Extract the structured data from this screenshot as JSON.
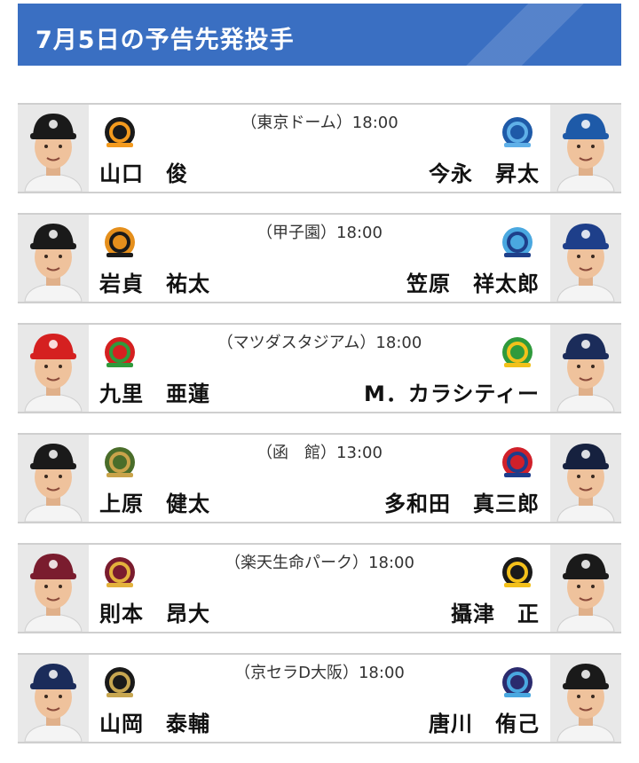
{
  "header": {
    "title": "7月5日の予告先発投手"
  },
  "colors": {
    "header_bg": "#3a6fc2"
  },
  "games": [
    {
      "venue": "（東京ドーム）18:00",
      "home": {
        "pitcher": "山口　俊",
        "logo_icon": "giants-logo-icon",
        "cap": "#1a1a1a",
        "logo_color": "#1a1a1a",
        "logo_accent": "#f39a1e"
      },
      "away": {
        "pitcher": "今永　昇太",
        "logo_icon": "baystars-logo-icon",
        "cap": "#1e5aa8",
        "logo_color": "#1e5aa8",
        "logo_accent": "#5fb0e8"
      }
    },
    {
      "venue": "（甲子園）18:00",
      "home": {
        "pitcher": "岩貞　祐太",
        "logo_icon": "tigers-logo-icon",
        "cap": "#1a1a1a",
        "logo_color": "#e58f1c",
        "logo_accent": "#1a1a1a"
      },
      "away": {
        "pitcher": "笠原　祥太郎",
        "logo_icon": "dragons-logo-icon",
        "cap": "#1e3f8a",
        "logo_color": "#4aa8e0",
        "logo_accent": "#1e3f8a"
      }
    },
    {
      "venue": "（マツダスタジアム）18:00",
      "home": {
        "pitcher": "九里　亜蓮",
        "logo_icon": "carp-logo-icon",
        "cap": "#d52020",
        "logo_color": "#d52020",
        "logo_accent": "#2f9a3c"
      },
      "away": {
        "pitcher": "M．カラシティー",
        "logo_icon": "swallows-logo-icon",
        "cap": "#1b2c5a",
        "logo_color": "#2f9a3c",
        "logo_accent": "#f2c11b"
      }
    },
    {
      "venue": "（函　館）13:00",
      "home": {
        "pitcher": "上原　健太",
        "logo_icon": "fighters-logo-icon",
        "cap": "#1a1a1a",
        "logo_color": "#4a6d2a",
        "logo_accent": "#c9a34a"
      },
      "away": {
        "pitcher": "多和田　真三郎",
        "logo_icon": "lions-logo-icon",
        "cap": "#16213f",
        "logo_color": "#d0202a",
        "logo_accent": "#1d3d8c"
      }
    },
    {
      "venue": "（楽天生命パーク）18:00",
      "home": {
        "pitcher": "則本　昂大",
        "logo_icon": "eagles-logo-icon",
        "cap": "#7a1c2e",
        "logo_color": "#7a1c2e",
        "logo_accent": "#e3b23c"
      },
      "away": {
        "pitcher": "攝津　正",
        "logo_icon": "hawks-logo-icon",
        "cap": "#1a1a1a",
        "logo_color": "#1a1a1a",
        "logo_accent": "#f3c01b"
      }
    },
    {
      "venue": "（京セラD大阪）18:00",
      "home": {
        "pitcher": "山岡　泰輔",
        "logo_icon": "buffaloes-logo-icon",
        "cap": "#1b2c5a",
        "logo_color": "#1a1a1a",
        "logo_accent": "#c7a650"
      },
      "away": {
        "pitcher": "唐川　侑己",
        "logo_icon": "marines-logo-icon",
        "cap": "#1a1a1a",
        "logo_color": "#2b2b6e",
        "logo_accent": "#4aa8e0"
      }
    }
  ]
}
